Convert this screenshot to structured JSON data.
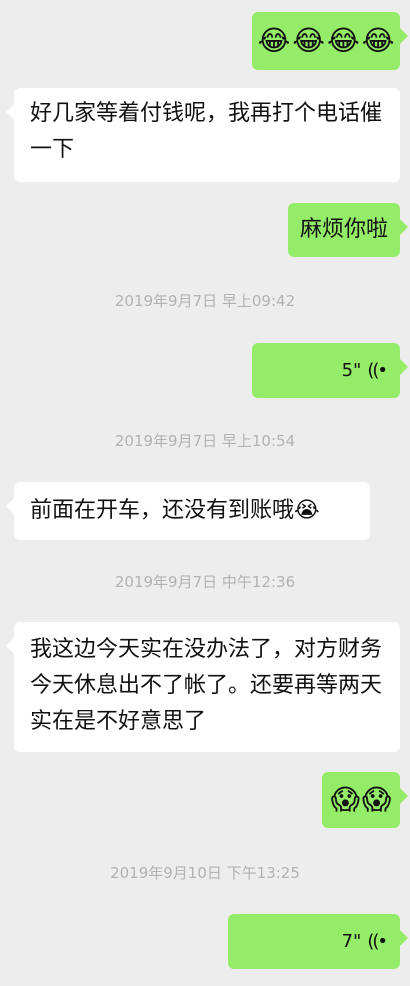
{
  "messages": {
    "m1": {
      "emojis": [
        "😂",
        "😂",
        "😂",
        "😂"
      ]
    },
    "m2": {
      "text": "好几家等着付钱呢，我再打个电话催一下"
    },
    "m3": {
      "text": "麻烦你啦"
    },
    "ts1": "2019年9月7日 早上09:42",
    "m4": {
      "duration": "5\"",
      "icon": "voice-wave-icon"
    },
    "ts2": "2019年9月7日 早上10:54",
    "m5": {
      "text": "前面在开车，还没有到账哦",
      "emoji": "😭"
    },
    "ts3": "2019年9月7日 中午12:36",
    "m6": {
      "text": "我这边今天实在没办法了，对方财务今天休息出不了帐了。还要再等两天实在是不好意思了"
    },
    "m7": {
      "emojis": [
        "😱",
        "😱"
      ]
    },
    "ts4": "2019年9月10日 下午13:25",
    "m8": {
      "duration": "7\"",
      "icon": "voice-wave-icon"
    }
  },
  "colors": {
    "background": "#ededed",
    "outgoing_bubble": "#95ec69",
    "incoming_bubble": "#ffffff",
    "timestamp": "#b2b2b2"
  }
}
